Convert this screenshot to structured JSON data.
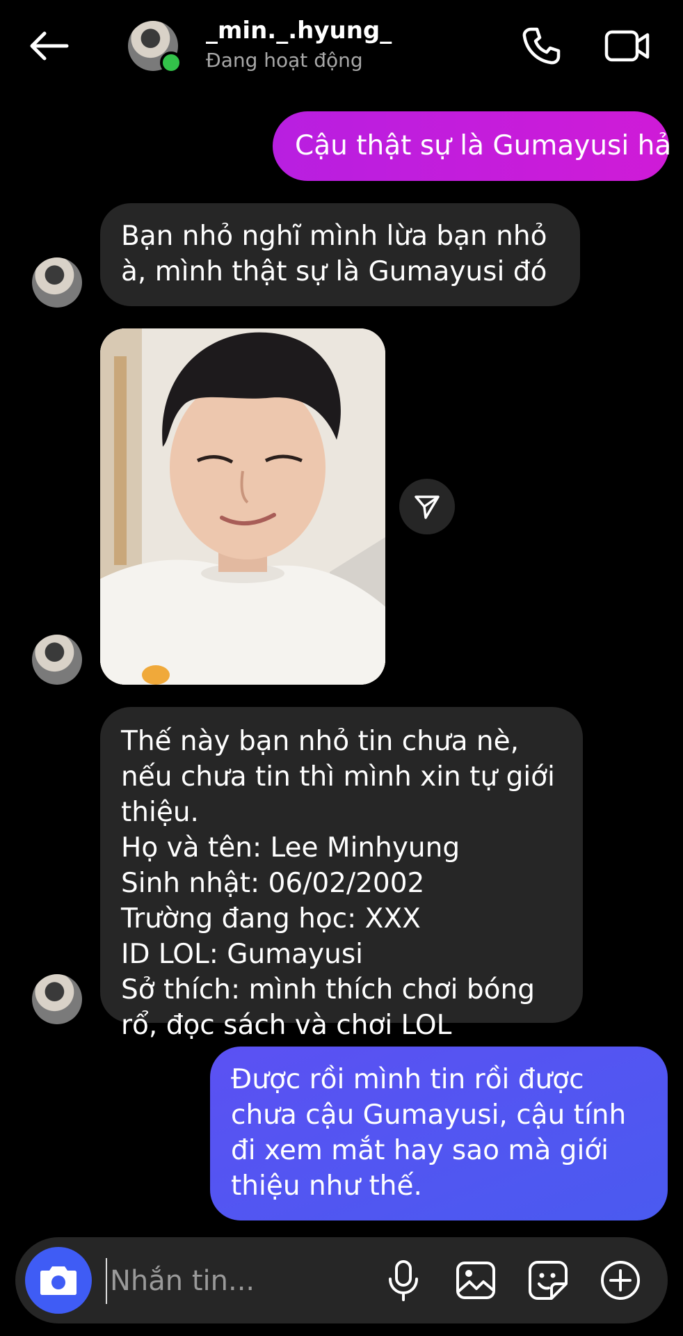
{
  "header": {
    "username": "_min._.hyung_",
    "status": "Đang hoạt động"
  },
  "messages": {
    "outgoing_1": "Cậu thật sự là Gumayusi hả",
    "incoming_1": "Bạn nhỏ nghĩ mình lừa bạn nhỏ à, mình thật sự là Gumayusi đó",
    "incoming_2_lines": [
      "Thế này bạn nhỏ tin chưa nè, nếu chưa tin thì mình xin tự giới thiệu.",
      "Họ và tên: Lee Minhyung",
      "Sinh nhật: 06/02/2002",
      "Trường đang học: XXX",
      "ID LOL: Gumayusi",
      "Sở thích: mình thích chơi bóng rổ, đọc sách và chơi LOL"
    ],
    "outgoing_2": "Được rồi mình tin rồi được chưa cậu Gumayusi, cậu tính đi xem mắt hay sao mà giới thiệu như thế."
  },
  "composer": {
    "placeholder": "Nhắn tin..."
  },
  "colors": {
    "background": "#000000",
    "incoming_bubble": "#262626",
    "outgoing_pink": "#c21ddc",
    "outgoing_blue": "#5452f2",
    "camera_button": "#3f5cf5",
    "online": "#33c24a"
  },
  "icons": [
    "back-arrow-icon",
    "phone-icon",
    "video-camera-icon",
    "share-icon",
    "camera-icon",
    "microphone-icon",
    "gallery-icon",
    "sticker-icon",
    "plus-icon"
  ]
}
